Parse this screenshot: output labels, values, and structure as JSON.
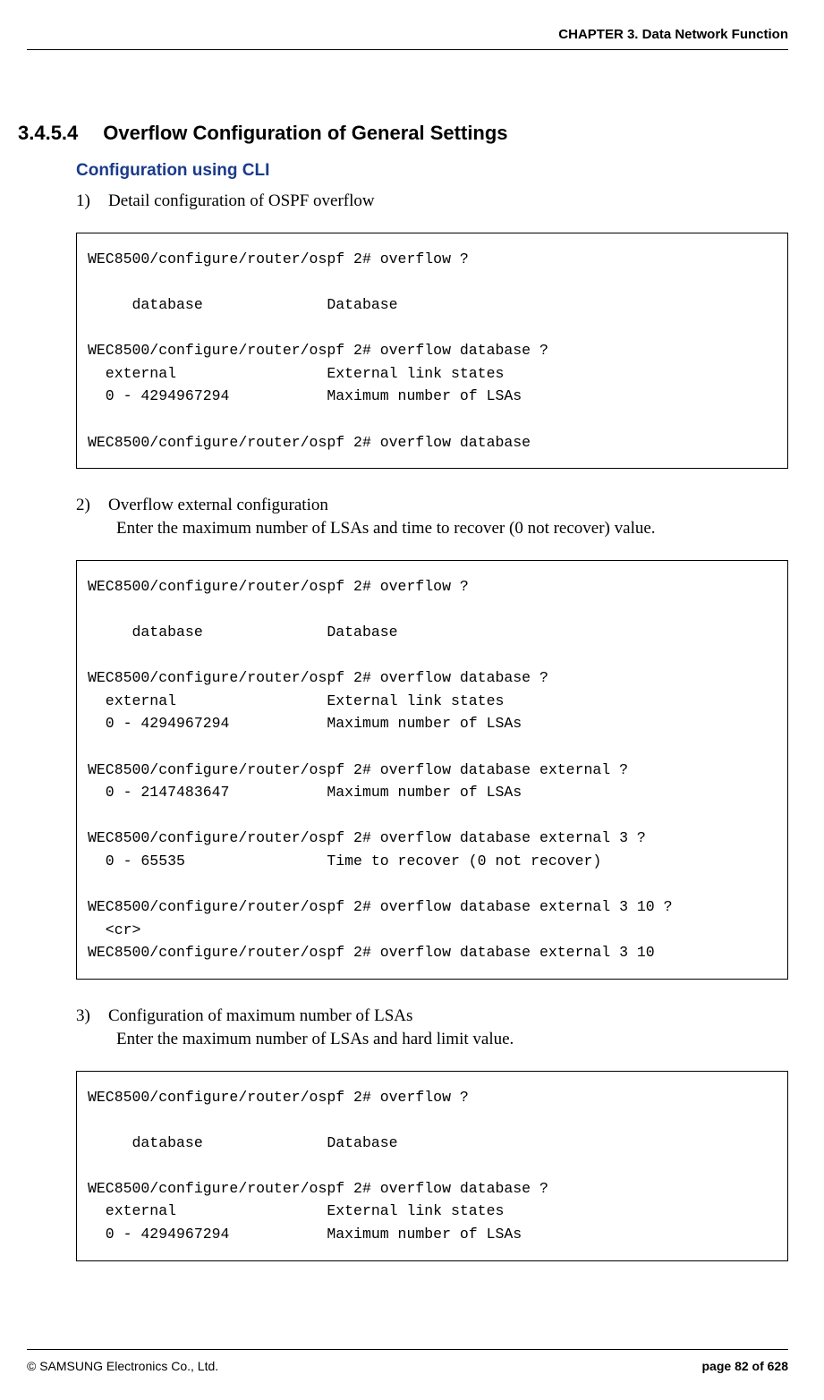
{
  "header": {
    "chapter": "CHAPTER 3. Data Network Function"
  },
  "section": {
    "number": "3.4.5.4",
    "title": "Overflow Configuration of General Settings"
  },
  "subheading": "Configuration using CLI",
  "items": [
    {
      "num": "1)",
      "desc": "Detail configuration of OSPF overflow",
      "sub": "",
      "code": "WEC8500/configure/router/ospf 2# overflow ?\n\n     database              Database\n\nWEC8500/configure/router/ospf 2# overflow database ?\n  external                 External link states\n  0 - 4294967294           Maximum number of LSAs\n\nWEC8500/configure/router/ospf 2# overflow database"
    },
    {
      "num": "2)",
      "desc": "Overflow external configuration",
      "sub": "Enter the maximum number of LSAs and time to recover (0 not recover) value.",
      "code": "WEC8500/configure/router/ospf 2# overflow ?\n\n     database              Database\n\nWEC8500/configure/router/ospf 2# overflow database ?\n  external                 External link states\n  0 - 4294967294           Maximum number of LSAs\n\nWEC8500/configure/router/ospf 2# overflow database external ?\n  0 - 2147483647           Maximum number of LSAs\n\nWEC8500/configure/router/ospf 2# overflow database external 3 ?\n  0 - 65535                Time to recover (0 not recover)\n\nWEC8500/configure/router/ospf 2# overflow database external 3 10 ?\n  <cr>\nWEC8500/configure/router/ospf 2# overflow database external 3 10"
    },
    {
      "num": "3)",
      "desc": "Configuration of maximum number of LSAs",
      "sub": "Enter the maximum number of LSAs and hard limit value.",
      "code": "WEC8500/configure/router/ospf 2# overflow ?\n\n     database              Database\n\nWEC8500/configure/router/ospf 2# overflow database ?\n  external                 External link states\n  0 - 4294967294           Maximum number of LSAs"
    }
  ],
  "footer": {
    "copyright": "© SAMSUNG Electronics Co., Ltd.",
    "page": "page 82 of 628"
  }
}
